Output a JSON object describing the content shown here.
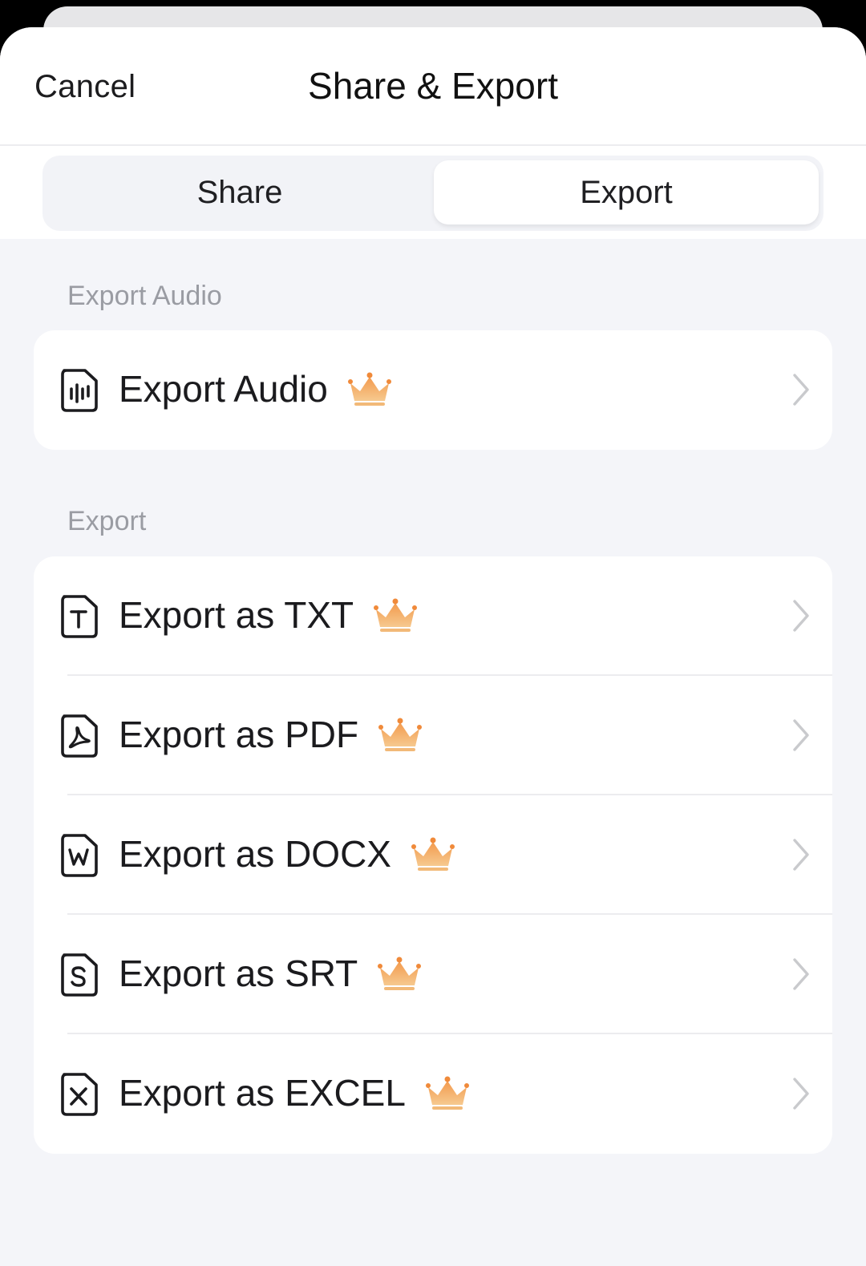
{
  "header": {
    "cancel_label": "Cancel",
    "title": "Share & Export"
  },
  "tabs": [
    {
      "label": "Share",
      "selected": false
    },
    {
      "label": "Export",
      "selected": true
    }
  ],
  "sections": [
    {
      "label": "Export Audio",
      "items": [
        {
          "label": "Export Audio",
          "icon": "audio-file-icon",
          "premium": true
        }
      ]
    },
    {
      "label": "Export",
      "items": [
        {
          "label": "Export as TXT",
          "icon": "txt-file-icon",
          "premium": true
        },
        {
          "label": "Export as PDF",
          "icon": "pdf-file-icon",
          "premium": true
        },
        {
          "label": "Export as DOCX",
          "icon": "docx-file-icon",
          "premium": true
        },
        {
          "label": "Export as SRT",
          "icon": "srt-file-icon",
          "premium": true
        },
        {
          "label": "Export as EXCEL",
          "icon": "excel-file-icon",
          "premium": true
        }
      ]
    }
  ],
  "colors": {
    "crown": "#e8914a",
    "background": "#f4f5f9",
    "card": "#ffffff",
    "section_label": "#9a9ca3"
  }
}
